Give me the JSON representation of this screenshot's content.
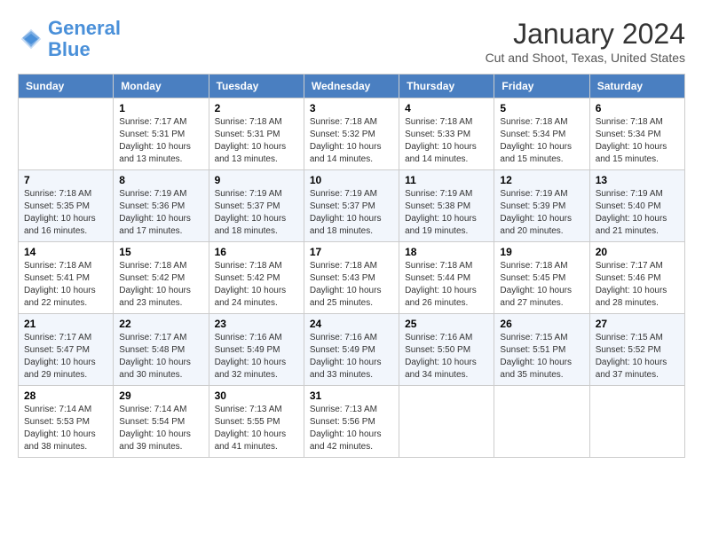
{
  "header": {
    "logo_line1": "General",
    "logo_line2": "Blue",
    "month": "January 2024",
    "location": "Cut and Shoot, Texas, United States"
  },
  "days_of_week": [
    "Sunday",
    "Monday",
    "Tuesday",
    "Wednesday",
    "Thursday",
    "Friday",
    "Saturday"
  ],
  "weeks": [
    [
      {
        "day": "",
        "info": ""
      },
      {
        "day": "1",
        "info": "Sunrise: 7:17 AM\nSunset: 5:31 PM\nDaylight: 10 hours\nand 13 minutes."
      },
      {
        "day": "2",
        "info": "Sunrise: 7:18 AM\nSunset: 5:31 PM\nDaylight: 10 hours\nand 13 minutes."
      },
      {
        "day": "3",
        "info": "Sunrise: 7:18 AM\nSunset: 5:32 PM\nDaylight: 10 hours\nand 14 minutes."
      },
      {
        "day": "4",
        "info": "Sunrise: 7:18 AM\nSunset: 5:33 PM\nDaylight: 10 hours\nand 14 minutes."
      },
      {
        "day": "5",
        "info": "Sunrise: 7:18 AM\nSunset: 5:34 PM\nDaylight: 10 hours\nand 15 minutes."
      },
      {
        "day": "6",
        "info": "Sunrise: 7:18 AM\nSunset: 5:34 PM\nDaylight: 10 hours\nand 15 minutes."
      }
    ],
    [
      {
        "day": "7",
        "info": "Sunrise: 7:18 AM\nSunset: 5:35 PM\nDaylight: 10 hours\nand 16 minutes."
      },
      {
        "day": "8",
        "info": "Sunrise: 7:19 AM\nSunset: 5:36 PM\nDaylight: 10 hours\nand 17 minutes."
      },
      {
        "day": "9",
        "info": "Sunrise: 7:19 AM\nSunset: 5:37 PM\nDaylight: 10 hours\nand 18 minutes."
      },
      {
        "day": "10",
        "info": "Sunrise: 7:19 AM\nSunset: 5:37 PM\nDaylight: 10 hours\nand 18 minutes."
      },
      {
        "day": "11",
        "info": "Sunrise: 7:19 AM\nSunset: 5:38 PM\nDaylight: 10 hours\nand 19 minutes."
      },
      {
        "day": "12",
        "info": "Sunrise: 7:19 AM\nSunset: 5:39 PM\nDaylight: 10 hours\nand 20 minutes."
      },
      {
        "day": "13",
        "info": "Sunrise: 7:19 AM\nSunset: 5:40 PM\nDaylight: 10 hours\nand 21 minutes."
      }
    ],
    [
      {
        "day": "14",
        "info": "Sunrise: 7:18 AM\nSunset: 5:41 PM\nDaylight: 10 hours\nand 22 minutes."
      },
      {
        "day": "15",
        "info": "Sunrise: 7:18 AM\nSunset: 5:42 PM\nDaylight: 10 hours\nand 23 minutes."
      },
      {
        "day": "16",
        "info": "Sunrise: 7:18 AM\nSunset: 5:42 PM\nDaylight: 10 hours\nand 24 minutes."
      },
      {
        "day": "17",
        "info": "Sunrise: 7:18 AM\nSunset: 5:43 PM\nDaylight: 10 hours\nand 25 minutes."
      },
      {
        "day": "18",
        "info": "Sunrise: 7:18 AM\nSunset: 5:44 PM\nDaylight: 10 hours\nand 26 minutes."
      },
      {
        "day": "19",
        "info": "Sunrise: 7:18 AM\nSunset: 5:45 PM\nDaylight: 10 hours\nand 27 minutes."
      },
      {
        "day": "20",
        "info": "Sunrise: 7:17 AM\nSunset: 5:46 PM\nDaylight: 10 hours\nand 28 minutes."
      }
    ],
    [
      {
        "day": "21",
        "info": "Sunrise: 7:17 AM\nSunset: 5:47 PM\nDaylight: 10 hours\nand 29 minutes."
      },
      {
        "day": "22",
        "info": "Sunrise: 7:17 AM\nSunset: 5:48 PM\nDaylight: 10 hours\nand 30 minutes."
      },
      {
        "day": "23",
        "info": "Sunrise: 7:16 AM\nSunset: 5:49 PM\nDaylight: 10 hours\nand 32 minutes."
      },
      {
        "day": "24",
        "info": "Sunrise: 7:16 AM\nSunset: 5:49 PM\nDaylight: 10 hours\nand 33 minutes."
      },
      {
        "day": "25",
        "info": "Sunrise: 7:16 AM\nSunset: 5:50 PM\nDaylight: 10 hours\nand 34 minutes."
      },
      {
        "day": "26",
        "info": "Sunrise: 7:15 AM\nSunset: 5:51 PM\nDaylight: 10 hours\nand 35 minutes."
      },
      {
        "day": "27",
        "info": "Sunrise: 7:15 AM\nSunset: 5:52 PM\nDaylight: 10 hours\nand 37 minutes."
      }
    ],
    [
      {
        "day": "28",
        "info": "Sunrise: 7:14 AM\nSunset: 5:53 PM\nDaylight: 10 hours\nand 38 minutes."
      },
      {
        "day": "29",
        "info": "Sunrise: 7:14 AM\nSunset: 5:54 PM\nDaylight: 10 hours\nand 39 minutes."
      },
      {
        "day": "30",
        "info": "Sunrise: 7:13 AM\nSunset: 5:55 PM\nDaylight: 10 hours\nand 41 minutes."
      },
      {
        "day": "31",
        "info": "Sunrise: 7:13 AM\nSunset: 5:56 PM\nDaylight: 10 hours\nand 42 minutes."
      },
      {
        "day": "",
        "info": ""
      },
      {
        "day": "",
        "info": ""
      },
      {
        "day": "",
        "info": ""
      }
    ]
  ]
}
